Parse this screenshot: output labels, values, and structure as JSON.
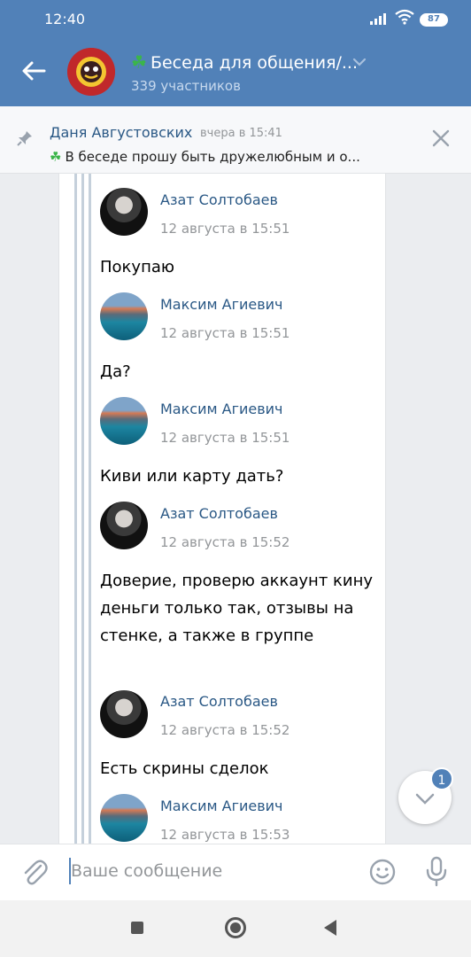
{
  "status_bar": {
    "time": "12:40",
    "battery": "87"
  },
  "header": {
    "title": "Беседа для общения/...",
    "subtitle": "339 участников",
    "title_icon": "clover-icon"
  },
  "pinned": {
    "author": "Даня Августовских",
    "date": "вчера в 15:41",
    "text": "В беседе прошу быть дружелюбным и о..."
  },
  "messages": [
    {
      "author": "Азат Солтобаев",
      "date": "12 августа в 15:51",
      "text": "Покупаю",
      "avatar": "man-photo"
    },
    {
      "author": "Максим Агиевич",
      "date": "12 августа в 15:51",
      "text": "Да?",
      "avatar": "lake-photo"
    },
    {
      "author": "Максим Агиевич",
      "date": "12 августа в 15:51",
      "text": "Киви или карту дать?",
      "avatar": "lake-photo"
    },
    {
      "author": "Азат Солтобаев",
      "date": "12 августа в 15:52",
      "text": "Доверие, проверю аккаунт кину деньги только так, отзывы на стенке, а также в группе",
      "avatar": "man-photo"
    },
    {
      "author": "Азат Солтобаев",
      "date": "12 августа в 15:52",
      "text": "Есть скрины сделок",
      "avatar": "man-photo"
    },
    {
      "author": "Максим Агиевич",
      "date": "12 августа в 15:53",
      "text": "",
      "avatar": "lake-photo"
    }
  ],
  "scroll_button": {
    "badge": "1"
  },
  "composer": {
    "placeholder": "Ваше сообщение"
  },
  "colors": {
    "accent": "#5181b8",
    "link": "#2a5885",
    "muted": "#939699"
  }
}
